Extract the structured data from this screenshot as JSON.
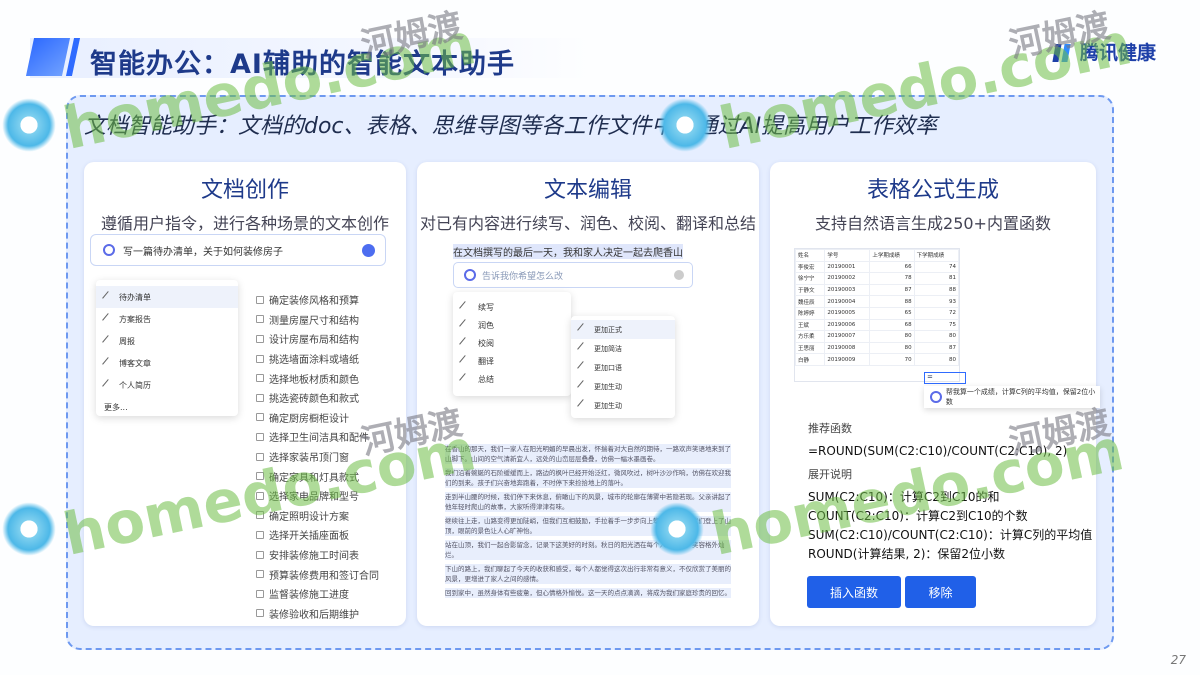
{
  "header": {
    "title": "智能办公：AI辅助的智能文本助手",
    "logo_text": "腾讯健康"
  },
  "subtitle": "文档智能助手：文档的doc、表格、思维导图等各工作文件中，通过AI提高用户工作效率",
  "cards": [
    {
      "title": "文档创作",
      "subtitle": "遵循用户指令，进行各种场景的文本创作",
      "input_text": "写一篇待办清单，关于如何装修房子",
      "menu": [
        "待办清单",
        "方案报告",
        "周报",
        "博客文章",
        "个人简历",
        "更多..."
      ],
      "checklist": [
        "确定装修风格和预算",
        "测量房屋尺寸和结构",
        "设计房屋布局和结构",
        "挑选墙面涂料或墙纸",
        "选择地板材质和颜色",
        "挑选瓷砖颜色和款式",
        "确定厨房橱柜设计",
        "选择卫生间洁具和配件",
        "选择家装吊顶门窗",
        "确定家具和灯具款式",
        "选择家电品牌和型号",
        "确定照明设计方案",
        "选择开关插座面板",
        "安排装修施工时间表",
        "预算装修费用和签订合同",
        "监督装修施工进度",
        "装修验收和后期维护"
      ]
    },
    {
      "title": "文本编辑",
      "subtitle": "对已有内容进行续写、润色、校阅、翻译和总结",
      "selected_line": "在文档撰写的最后一天，我和家人决定一起去爬香山",
      "input_placeholder": "告诉我你希望怎么改",
      "menu_main": [
        "续写",
        "润色",
        "校阅",
        "翻译",
        "总结"
      ],
      "menu_sub": [
        "更加正式",
        "更加简洁",
        "更加口语",
        "更加生动",
        "更加生动"
      ],
      "paragraphs": [
        "在香山的那天，我们一家人在阳光明媚的早晨出发，怀揣着对大自然的期待，一路欢声笑语地来到了山脚下。山间的空气清新宜人，远处的山峦层层叠叠，仿佛一幅水墨画卷。",
        "我们沿着蜿蜒的石阶缓缓而上，路边的枫叶已经开始泛红，微风吹过，树叶沙沙作响，仿佛在欢迎我们的到来。孩子们兴奋地奔跑着，不时停下来捡拾地上的落叶。",
        "走到半山腰的时候，我们停下来休息，俯瞰山下的风景，城市的轮廓在薄雾中若隐若现。父亲讲起了他年轻时爬山的故事，大家听得津津有味。",
        "继续往上走，山路变得更加陡峭，但我们互相鼓励，手拉着手一步步向上攀登。终于，我们登上了山顶，眼前的景色让人心旷神怡。",
        "站在山顶，我们一起合影留念，记录下这美好的时刻。秋日的阳光洒在每个人的脸上，笑容格外灿烂。",
        "下山的路上，我们聊起了今天的收获和感受，每个人都觉得这次出行非常有意义，不仅欣赏了美丽的风景，更增进了家人之间的感情。",
        "回到家中，虽然身体有些疲惫，但心情格外愉悦。这一天的点点滴滴，将成为我们家庭珍贵的回忆。"
      ]
    },
    {
      "title": "表格公式生成",
      "subtitle": "支持自然语言生成250+内置函数",
      "sheet_header": [
        "姓名",
        "学号",
        "上学期成绩",
        "下学期成绩"
      ],
      "sheet_rows": [
        [
          "李俊宏",
          "20190001",
          "66",
          "74"
        ],
        [
          "徐宁宁",
          "20190002",
          "78",
          "81"
        ],
        [
          "于静文",
          "20190003",
          "87",
          "88"
        ],
        [
          "魏佳辰",
          "20190004",
          "88",
          "93"
        ],
        [
          "陈婷婷",
          "20190005",
          "65",
          "72"
        ],
        [
          "王斌",
          "20190006",
          "68",
          "75"
        ],
        [
          "方乐柔",
          "20190007",
          "80",
          "80"
        ],
        [
          "王思丽",
          "20190008",
          "80",
          "87"
        ],
        [
          "白静",
          "20190009",
          "70",
          "80"
        ]
      ],
      "cell_value": "=",
      "cell_tip": "帮我算一个成绩，计算C列的平均值，保留2位小数",
      "recommend_label": "推荐函数",
      "formula": "=ROUND(SUM(C2:C10)/COUNT(C2:C10), 2)",
      "explain_label": "展开说明",
      "explanations": [
        "SUM(C2:C10)：计算C2到C10的和",
        "COUNT(C2:C10)：计算C2到C10的个数",
        "SUM(C2:C10)/COUNT(C2:C10)：计算C列的平均值",
        "ROUND(计算结果, 2)：保留2位小数"
      ],
      "buttons": [
        "插入函数",
        "移除"
      ]
    }
  ],
  "watermarks": [
    "homedo.com",
    "河姆渡"
  ],
  "page_number": "27",
  "colors": {
    "accent": "#2060e8",
    "title": "#1e3a8a",
    "frame": "#e6eeff"
  }
}
